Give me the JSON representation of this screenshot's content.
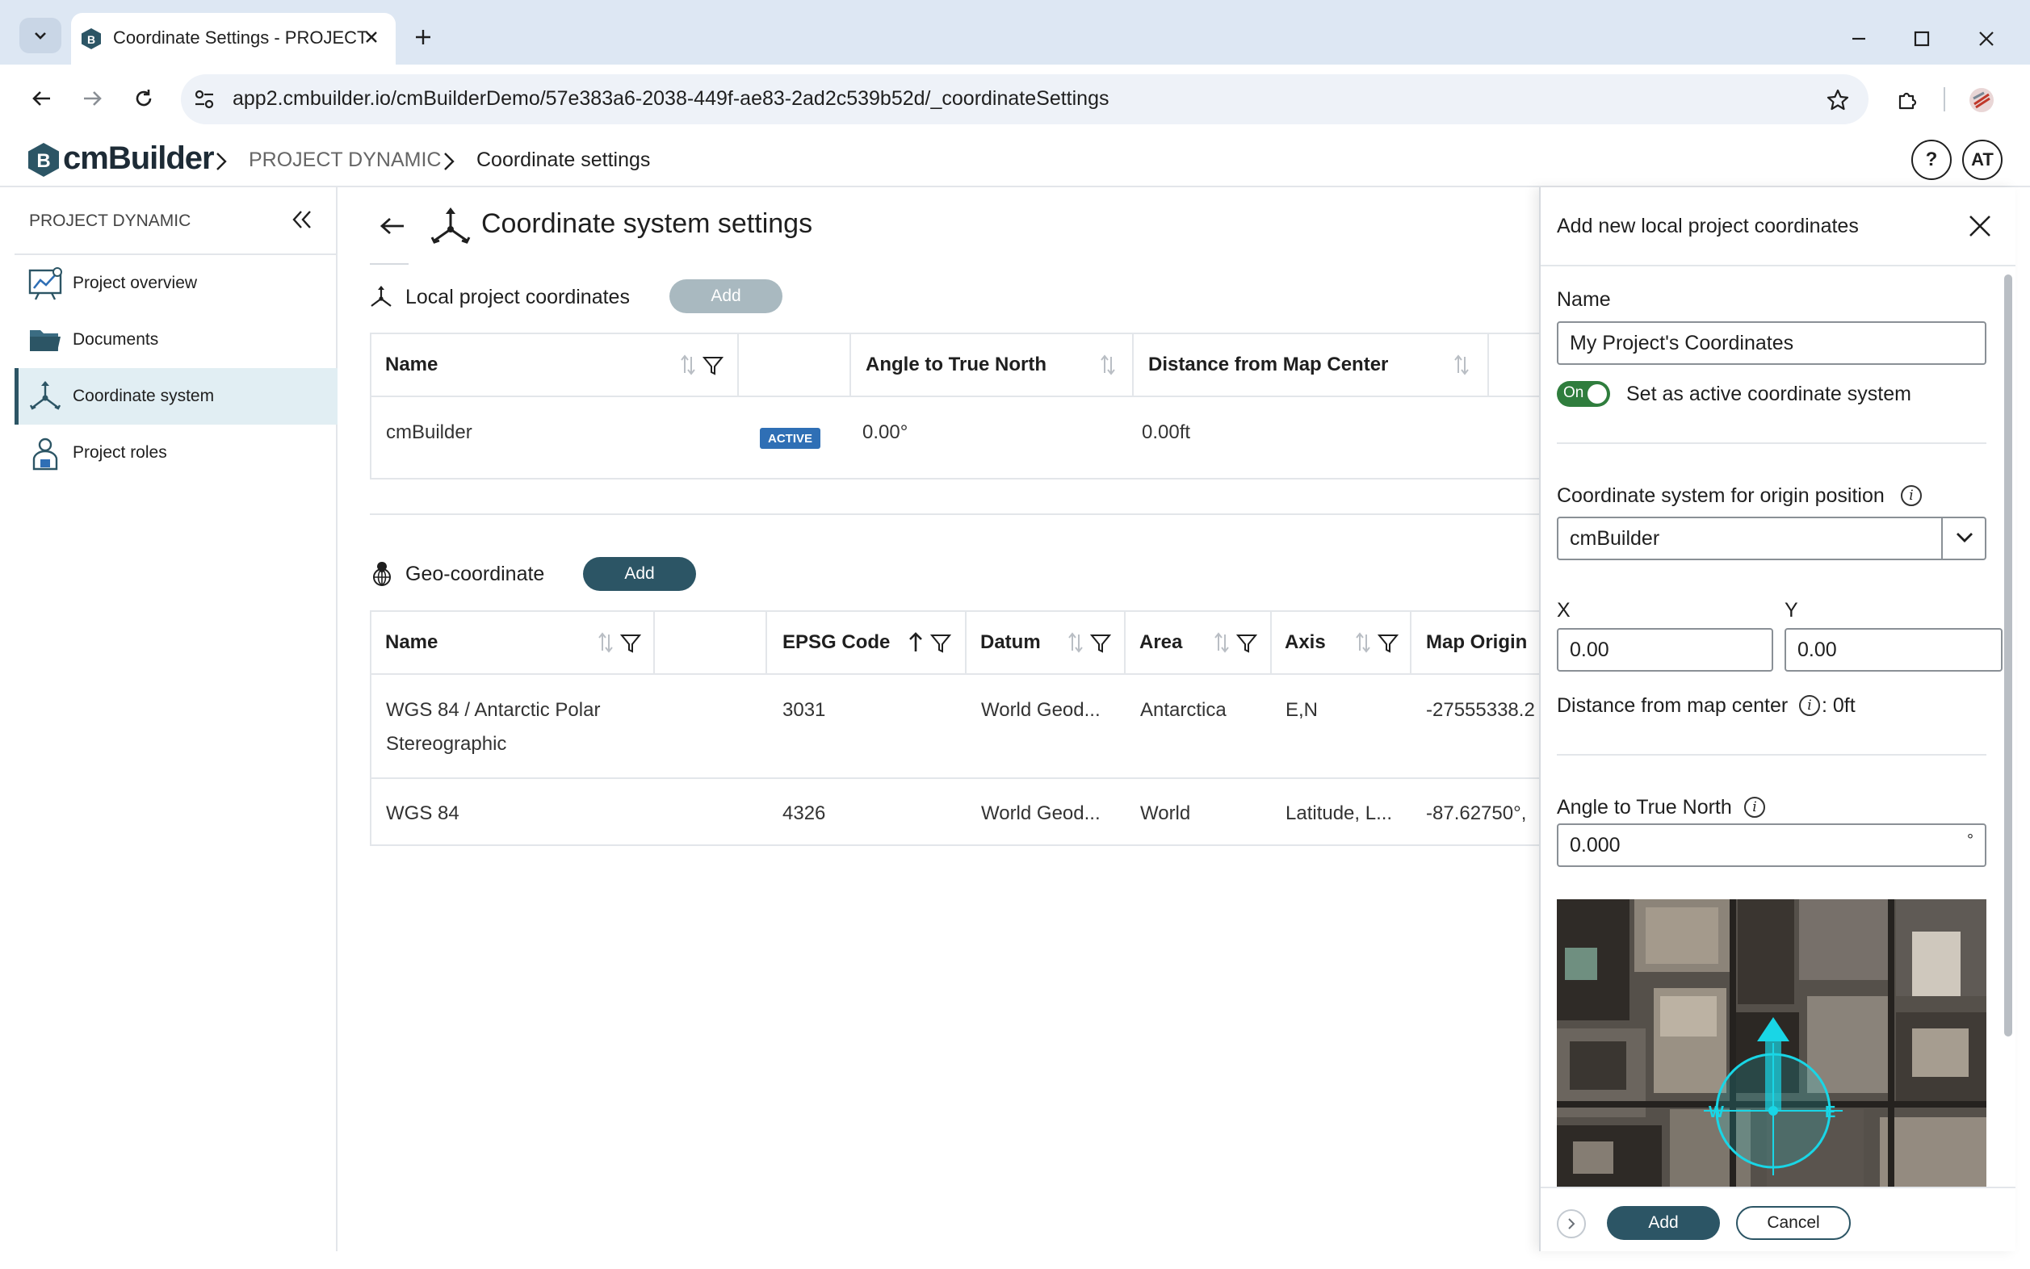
{
  "browser": {
    "tab_title": "Coordinate Settings - PROJECT",
    "url": "app2.cmbuilder.io/cmBuilderDemo/57e383a6-2038-449f-ae83-2ad2c539b52d/_coordinateSettings"
  },
  "app": {
    "logo_text": "cmBuilder",
    "logo_mark": "B",
    "breadcrumb": [
      "PROJECT DYNAMIC",
      "Coordinate settings"
    ],
    "help_label": "?",
    "avatar_initials": "AT"
  },
  "sidebar": {
    "project_name": "PROJECT DYNAMIC",
    "items": [
      {
        "label": "Project overview",
        "icon": "chart-board-icon",
        "active": false
      },
      {
        "label": "Documents",
        "icon": "folder-icon",
        "active": false
      },
      {
        "label": "Coordinate system",
        "icon": "axes-icon",
        "active": true
      },
      {
        "label": "Project roles",
        "icon": "person-badge-icon",
        "active": false
      }
    ]
  },
  "main": {
    "title": "Coordinate system settings",
    "local": {
      "title": "Local project coordinates",
      "add_label": "Add",
      "columns": [
        "Name",
        "Angle to True North",
        "Distance from Map Center"
      ],
      "rows": [
        {
          "name": "cmBuilder",
          "badge": "ACTIVE",
          "angle": "0.00°",
          "distance": "0.00ft"
        }
      ]
    },
    "geo": {
      "title": "Geo-coordinate",
      "add_label": "Add",
      "columns": [
        "Name",
        "EPSG Code",
        "Datum",
        "Area",
        "Axis",
        "Map Origin"
      ],
      "rows": [
        {
          "name_line1": "WGS 84 / Antarctic Polar",
          "name_line2": "Stereographic",
          "epsg": "3031",
          "datum": "World Geod...",
          "area": "Antarctica",
          "axis": "E,N",
          "origin": "-27555338.2"
        },
        {
          "name_line1": "WGS 84",
          "name_line2": "",
          "epsg": "4326",
          "datum": "World Geod...",
          "area": "World",
          "axis": "Latitude, L...",
          "origin": "-87.62750°,"
        }
      ]
    }
  },
  "panel": {
    "title": "Add new local project coordinates",
    "name_label": "Name",
    "name_value": "My Project's Coordinates",
    "toggle_state": "On",
    "toggle_label": "Set as active coordinate system",
    "origin_label": "Coordinate system for origin position",
    "origin_value": "cmBuilder",
    "x_label": "X",
    "x_value": "0.00",
    "y_label": "Y",
    "y_value": "0.00",
    "distance_prefix": "Distance from map center",
    "distance_value": ": 0ft",
    "angle_label": "Angle to True North",
    "angle_value": "0.000",
    "angle_unit": "°",
    "compass_w": "W",
    "compass_e": "E",
    "add_label": "Add",
    "cancel_label": "Cancel"
  },
  "colors": {
    "accent": "#2c5565",
    "disabled_button": "#a9b9c0",
    "badge": "#2f6fb5",
    "toggle_on": "#2f7d3d",
    "compass": "#19d6e6"
  }
}
